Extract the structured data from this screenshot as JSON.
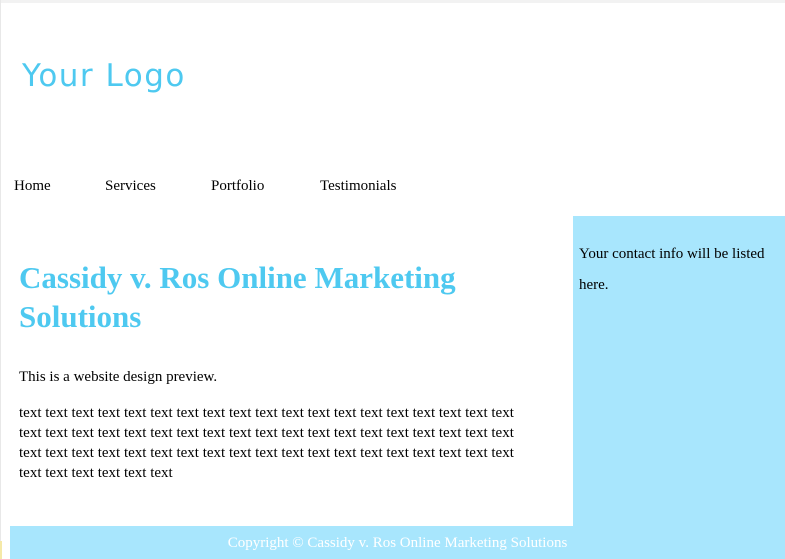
{
  "header": {
    "logo_text": "Your Logo"
  },
  "nav": {
    "items": [
      {
        "label": "Home"
      },
      {
        "label": "Services"
      },
      {
        "label": "Portfolio"
      },
      {
        "label": "Testimonials"
      }
    ]
  },
  "main": {
    "title": "Cassidy v. Ros Online Marketing Solutions",
    "intro": "This is a website design preview.",
    "body": "text text text text text text text text text text text text text text text text text text text text text text text text text text text text text text text text text text text text text text text text text text text text text text text text text text text text text text text text text text text text text text text"
  },
  "sidebar": {
    "contact_text": "Your contact info will be listed here."
  },
  "footer": {
    "copyright": "Copyright © Cassidy v. Ros Online Marketing Solutions"
  },
  "colors": {
    "accent": "#4ec9f0",
    "panel": "#a8e6fd",
    "footer_text": "#ffffff"
  }
}
